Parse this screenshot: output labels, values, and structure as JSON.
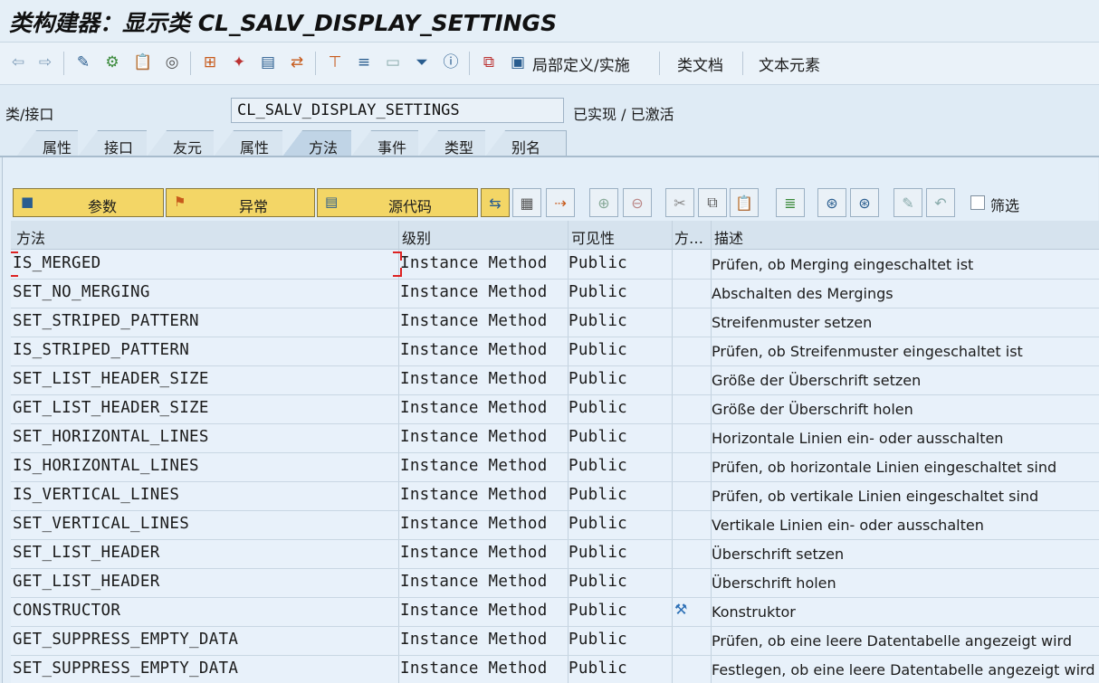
{
  "window": {
    "title": "类构建器：显示类 CL_SALV_DISPLAY_SETTINGS"
  },
  "toolbar": {
    "local_definitions_label": "局部定义/实施",
    "class_docs_label": "类文档",
    "text_elements_label": "文本元素",
    "icons": [
      "back-arrow-icon",
      "forward-arrow-icon",
      "glasses-pencil-icon",
      "objects-icon",
      "paste-icon",
      "target-icon",
      "hierarchy-icon",
      "magic-wand-icon",
      "display-icon",
      "transfer-icon",
      "org-chart-icon",
      "align-icon",
      "window-icon",
      "filter-icon",
      "info-icon",
      "local-class-icon",
      "local-doc-icon"
    ]
  },
  "class_row": {
    "label": "类/接口",
    "class_name": "CL_SALV_DISPLAY_SETTINGS",
    "status": "已实现 / 已激活"
  },
  "tabs": [
    {
      "label": "属性",
      "active": false
    },
    {
      "label": "接口",
      "active": false
    },
    {
      "label": "友元",
      "active": false
    },
    {
      "label": "属性",
      "active": false
    },
    {
      "label": "方法",
      "active": true
    },
    {
      "label": "事件",
      "active": false
    },
    {
      "label": "类型",
      "active": false
    },
    {
      "label": "别名",
      "active": false
    }
  ],
  "method_toolbar": {
    "parameters_label": "参数",
    "exceptions_label": "异常",
    "source_code_label": "源代码",
    "filter_label": "筛选",
    "filter_checked": false
  },
  "table": {
    "headers": {
      "method": "方法",
      "level": "级别",
      "visibility": "可见性",
      "method_type": "方…",
      "description": "描述"
    },
    "rows": [
      {
        "method": "IS_MERGED",
        "level": "Instance Method",
        "visibility": "Public",
        "flag": "",
        "description": "Prüfen, ob Merging eingeschaltet ist"
      },
      {
        "method": "SET_NO_MERGING",
        "level": "Instance Method",
        "visibility": "Public",
        "flag": "",
        "description": "Abschalten des Mergings"
      },
      {
        "method": "SET_STRIPED_PATTERN",
        "level": "Instance Method",
        "visibility": "Public",
        "flag": "",
        "description": "Streifenmuster setzen"
      },
      {
        "method": "IS_STRIPED_PATTERN",
        "level": "Instance Method",
        "visibility": "Public",
        "flag": "",
        "description": "Prüfen, ob Streifenmuster eingeschaltet ist"
      },
      {
        "method": "SET_LIST_HEADER_SIZE",
        "level": "Instance Method",
        "visibility": "Public",
        "flag": "",
        "description": "Größe der Überschrift setzen"
      },
      {
        "method": "GET_LIST_HEADER_SIZE",
        "level": "Instance Method",
        "visibility": "Public",
        "flag": "",
        "description": "Größe der Überschrift holen"
      },
      {
        "method": "SET_HORIZONTAL_LINES",
        "level": "Instance Method",
        "visibility": "Public",
        "flag": "",
        "description": "Horizontale Linien ein- oder ausschalten"
      },
      {
        "method": "IS_HORIZONTAL_LINES",
        "level": "Instance Method",
        "visibility": "Public",
        "flag": "",
        "description": "Prüfen, ob horizontale Linien eingeschaltet sind"
      },
      {
        "method": "IS_VERTICAL_LINES",
        "level": "Instance Method",
        "visibility": "Public",
        "flag": "",
        "description": "Prüfen, ob vertikale Linien eingeschaltet sind"
      },
      {
        "method": "SET_VERTICAL_LINES",
        "level": "Instance Method",
        "visibility": "Public",
        "flag": "",
        "description": "Vertikale Linien ein- oder ausschalten"
      },
      {
        "method": "SET_LIST_HEADER",
        "level": "Instance Method",
        "visibility": "Public",
        "flag": "",
        "description": "Überschrift setzen"
      },
      {
        "method": "GET_LIST_HEADER",
        "level": "Instance Method",
        "visibility": "Public",
        "flag": "",
        "description": "Überschrift holen"
      },
      {
        "method": "CONSTRUCTOR",
        "level": "Instance Method",
        "visibility": "Public",
        "flag": "constructor-icon",
        "description": "Konstruktor"
      },
      {
        "method": "GET_SUPPRESS_EMPTY_DATA",
        "level": "Instance Method",
        "visibility": "Public",
        "flag": "",
        "description": "Prüfen, ob eine leere Datentabelle angezeigt wird"
      },
      {
        "method": "SET_SUPPRESS_EMPTY_DATA",
        "level": "Instance Method",
        "visibility": "Public",
        "flag": "",
        "description": "Festlegen, ob eine leere Datentabelle angezeigt wird"
      }
    ]
  },
  "colors": {
    "accent_button": "#f3d666",
    "background": "#dfebf5",
    "selection": "#dd2222"
  }
}
